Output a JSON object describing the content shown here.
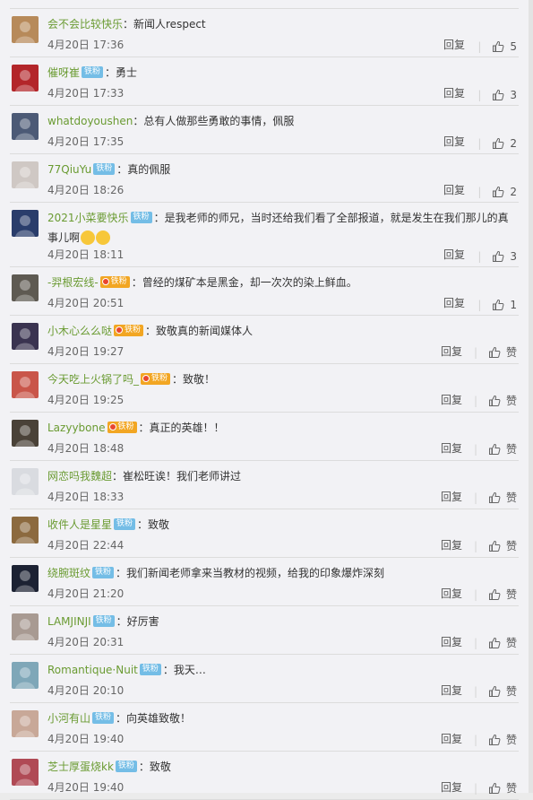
{
  "actions": {
    "reply": "回复",
    "like_word": "赞"
  },
  "comments": [
    {
      "name": "会不会比较快乐",
      "badge": "",
      "text": "：新闻人respect",
      "time": "4月20日 17:36",
      "likes": "5",
      "avatar": "#b78a5a"
    },
    {
      "name": "催呀崔",
      "badge": "铁粉",
      "text": "：勇士",
      "time": "4月20日 17:33",
      "likes": "3",
      "avatar": "#b3262a"
    },
    {
      "name": "whatdoyoushen",
      "badge": "",
      "text": "：总有人做那些勇敢的事情，佩服",
      "time": "4月20日 17:35",
      "likes": "2",
      "avatar": "#4c5a76"
    },
    {
      "name": "77QiuYu",
      "badge": "铁粉",
      "text": "：真的佩服",
      "time": "4月20日 18:26",
      "likes": "2",
      "avatar": "#cfc8c4"
    },
    {
      "name": "2021小菜要快乐",
      "badge": "铁粉",
      "text": "：是我老师的师兄，当时还给我们看了全部报道，就是发生在我们那儿的真",
      "text2": "事儿啊",
      "time": "4月20日 18:11",
      "likes": "3",
      "avatar": "#2a3d6b"
    },
    {
      "name": "-羿根宏线-",
      "badge": "铁粉",
      "text": "：曾经的煤矿本是黑金，却一次次的染上鲜血。",
      "time": "4月20日 20:51",
      "likes": "1",
      "avatar": "#5e5a52"
    },
    {
      "name": "小木心么么哒",
      "badge": "铁粉",
      "text": "：致敬真的新闻媒体人",
      "time": "4月20日 19:27",
      "likes": "",
      "avatar": "#3a3350"
    },
    {
      "name": "今天吃上火锅了吗_",
      "badge": "铁粉",
      "text": "：致敬！",
      "time": "4月20日 19:25",
      "likes": "",
      "avatar": "#c9564a"
    },
    {
      "name": "Lazyybone",
      "badge": "铁粉",
      "text": "：真正的英雄！！",
      "time": "4月20日 18:48",
      "likes": "",
      "avatar": "#4a4238"
    },
    {
      "name": "网恋吗我魏超",
      "badge": "",
      "text": "：崔松旺诶！我们老师讲过",
      "time": "4月20日 18:33",
      "likes": "",
      "avatar": "#d9dbe0"
    },
    {
      "name": "收件人是星星",
      "badge": "铁粉",
      "text": "：致敬",
      "time": "4月20日 22:44",
      "likes": "",
      "avatar": "#8c6a3f"
    },
    {
      "name": "绕腕斑纹",
      "badge": "铁粉",
      "text": "：我们新闻老师拿来当教材的视频，给我的印象爆炸深刻",
      "time": "4月20日 21:20",
      "likes": "",
      "avatar": "#1c2233"
    },
    {
      "name": "LAMJINJI",
      "badge": "铁粉",
      "text": "：好厉害",
      "time": "4月20日 20:31",
      "likes": "",
      "avatar": "#a89a92"
    },
    {
      "name": "Romantique·Nuit",
      "badge": "铁粉",
      "text": "：我天…",
      "time": "4月20日 20:10",
      "likes": "",
      "avatar": "#7fa7b8"
    },
    {
      "name": "小河有山",
      "badge": "铁粉",
      "text": "：向英雄致敬！",
      "time": "4月20日 19:40",
      "likes": "",
      "avatar": "#c8a898"
    },
    {
      "name": "芝士厚蛋烧kk",
      "badge": "铁粉",
      "text": "：致敬",
      "time": "4月20日 19:40",
      "likes": "",
      "avatar": "#b04a55"
    }
  ]
}
